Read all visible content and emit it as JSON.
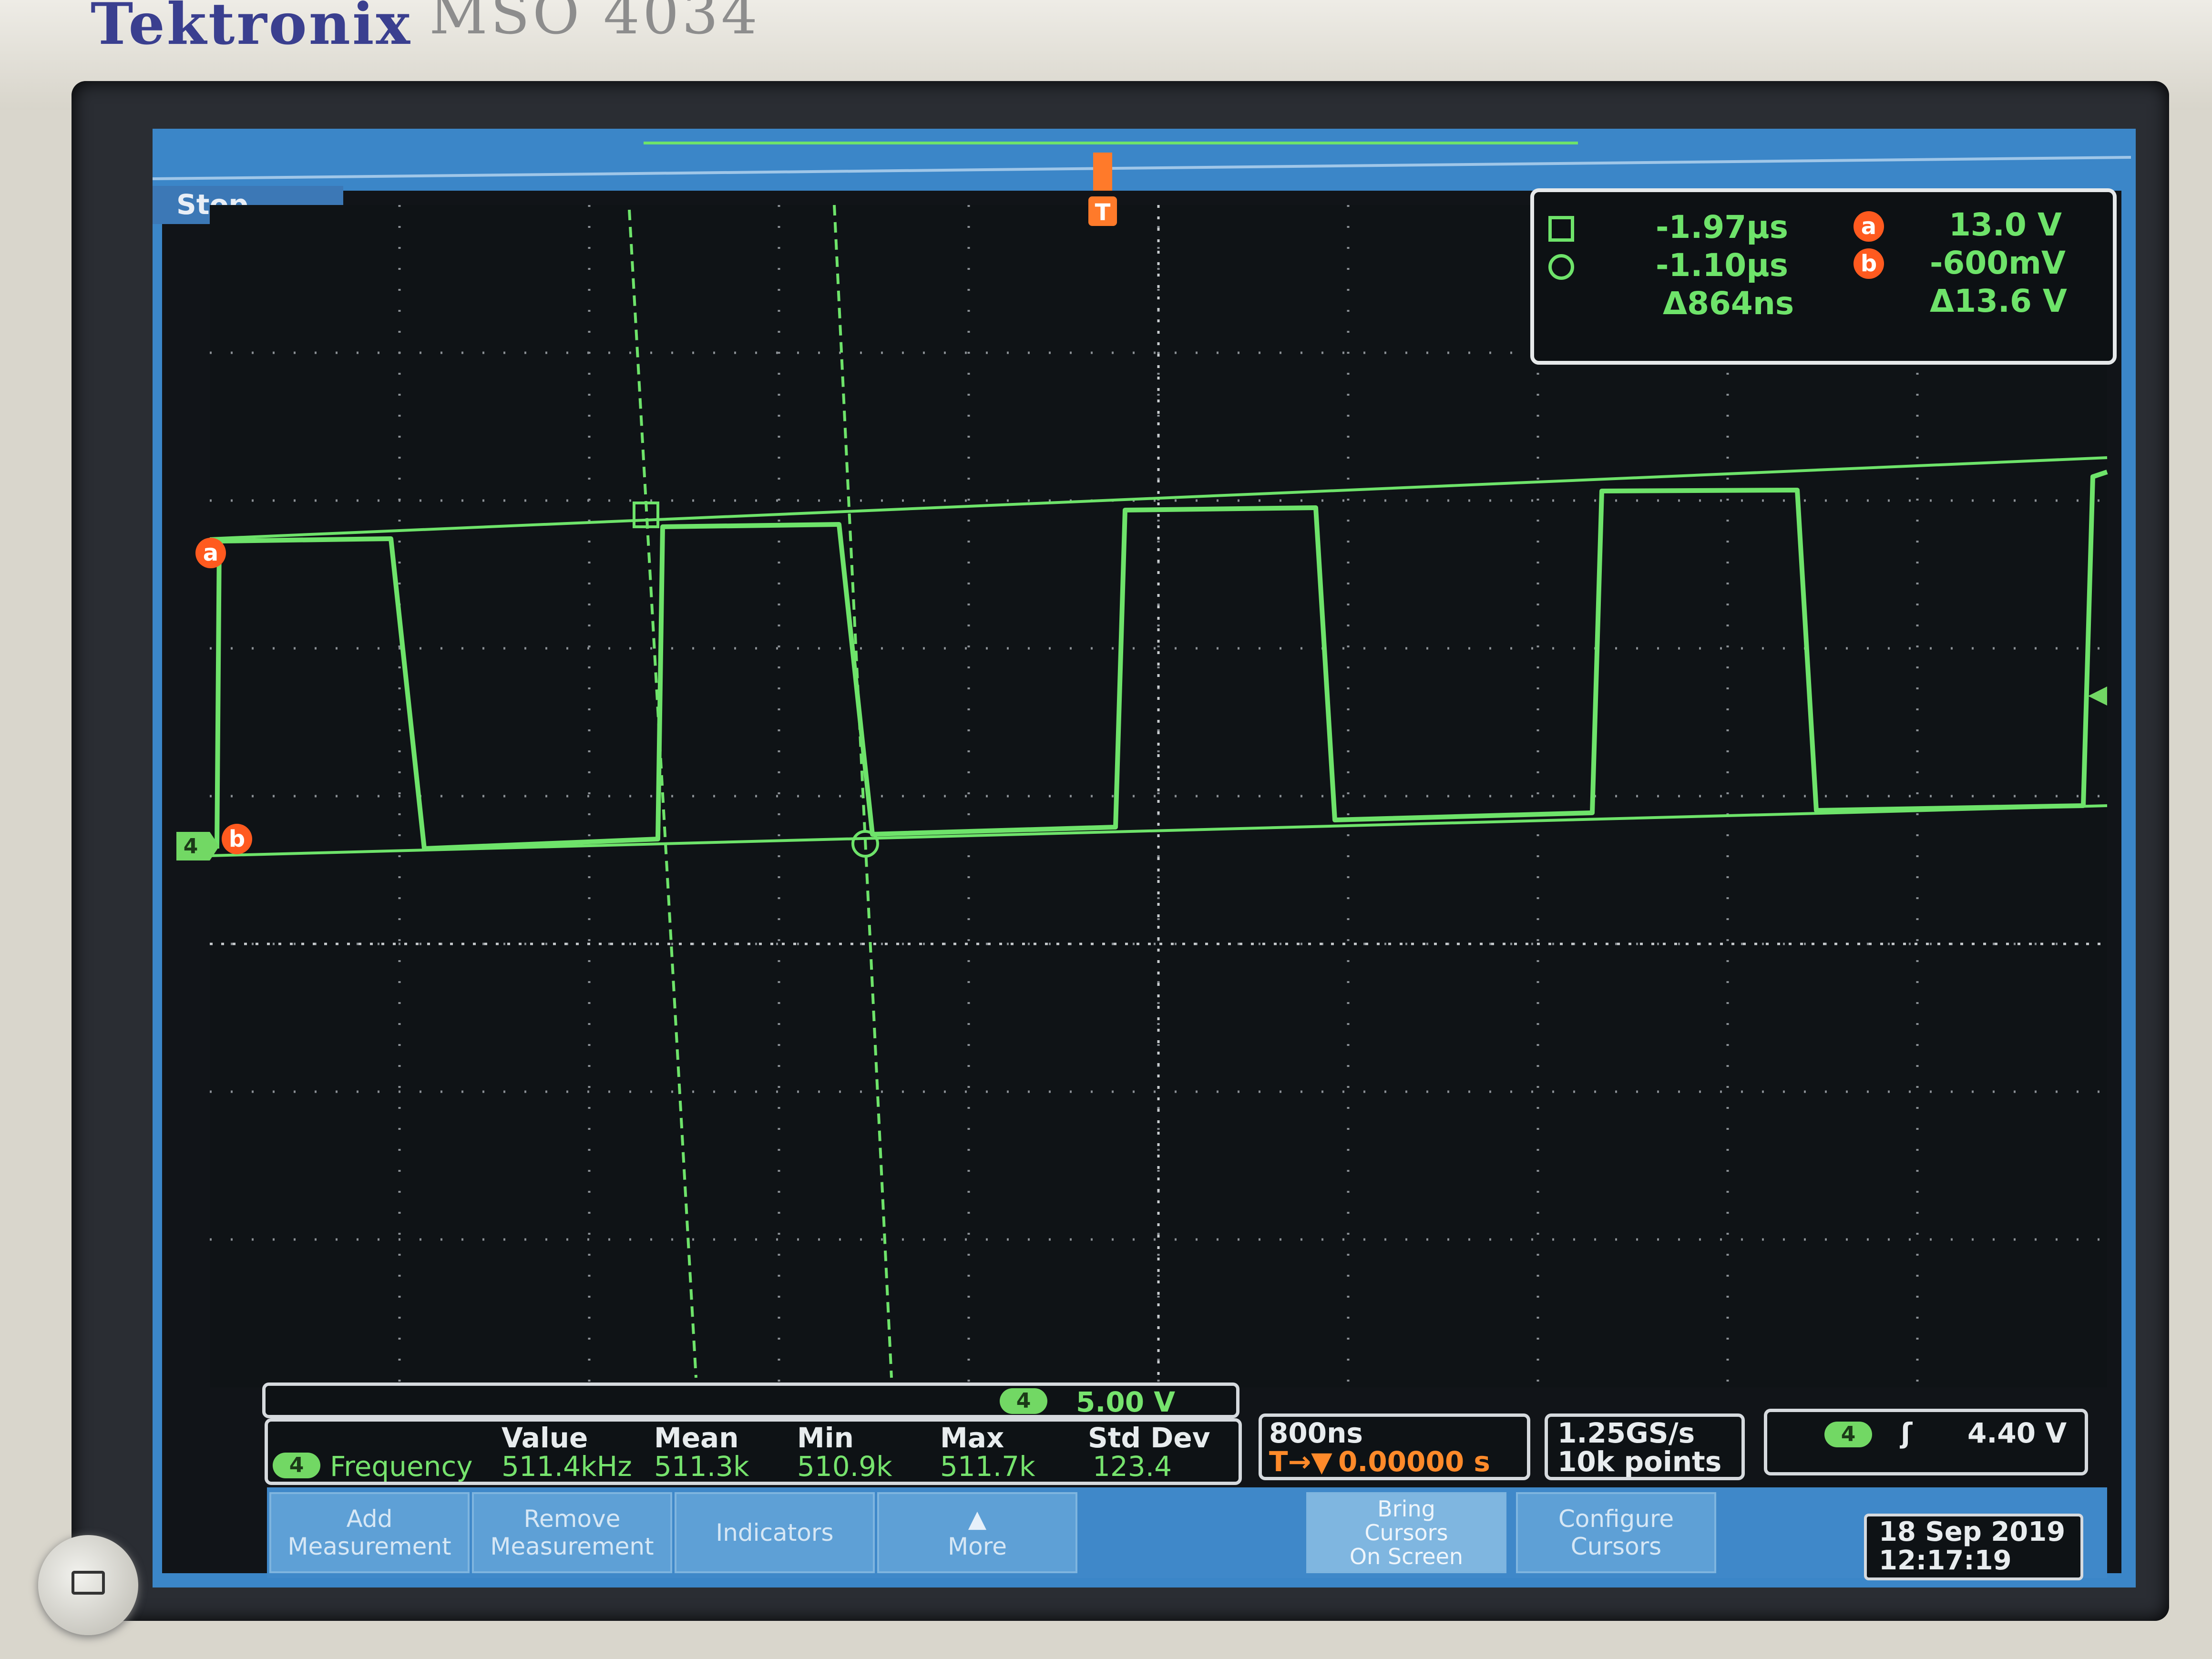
{
  "device": {
    "brand": "Tektronix",
    "model": "MSO 4034"
  },
  "status": {
    "acquisition": "Stop"
  },
  "cursors": {
    "time_a": "-1.97µs",
    "time_b": "-1.10µs",
    "time_delta": "Δ864ns",
    "volt_a": "13.0 V",
    "volt_b": "-600mV",
    "volt_delta": "Δ13.6 V",
    "marker_a": "a",
    "marker_b": "b"
  },
  "channel": {
    "number": "4",
    "scale": "5.00 V",
    "color": "#6ee36a"
  },
  "measurement": {
    "headers": [
      "Value",
      "Mean",
      "Min",
      "Max",
      "Std Dev"
    ],
    "name": "Frequency",
    "values": [
      "511.4kHz",
      "511.3k",
      "510.9k",
      "511.7k",
      "123.4"
    ]
  },
  "horizontal": {
    "time_div": "800ns",
    "delay": "0.00000 s"
  },
  "acquisition": {
    "sample_rate": "1.25GS/s",
    "record_length": "10k points"
  },
  "trigger": {
    "channel": "4",
    "level": "4.40 V",
    "marker": "T"
  },
  "buttons": {
    "add_measurement": [
      "Add",
      "Measurement"
    ],
    "remove_measurement": [
      "Remove",
      "Measurement"
    ],
    "indicators": "Indicators",
    "more": "More",
    "bring_cursors": [
      "Bring",
      "Cursors",
      "On Screen"
    ],
    "configure_cursors": [
      "Configure",
      "Cursors"
    ]
  },
  "datetime": {
    "date": "18 Sep 2019",
    "time": "12:17:19"
  },
  "waveform": {
    "type": "square",
    "frequency_khz": 511.4,
    "high_v": 13.0,
    "low_v": -0.6
  },
  "colors": {
    "trace": "#6ee36a",
    "cursor_marker": "#ff5a1f",
    "menu_blue": "#3f88c9"
  }
}
